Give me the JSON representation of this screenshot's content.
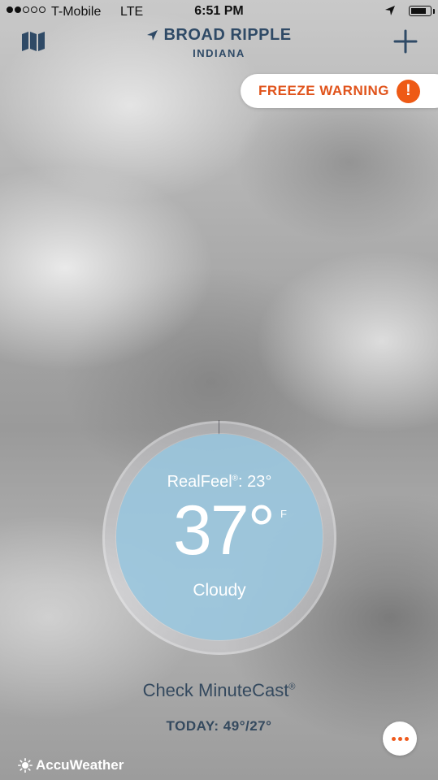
{
  "status_bar": {
    "carrier": "T-Mobile",
    "network": "LTE",
    "time": "6:51 PM",
    "signal_dots_filled": 2,
    "signal_dots_total": 5,
    "battery_level": 0.85
  },
  "header": {
    "city": "BROAD RIPPLE",
    "state": "INDIANA",
    "map_icon": "map-icon",
    "add_icon": "plus-icon"
  },
  "alert": {
    "label": "FREEZE WARNING",
    "icon_glyph": "!",
    "color": "#ee5a15"
  },
  "current": {
    "realfeel_label": "RealFeel",
    "realfeel_mark": "®",
    "realfeel_value": ": 23°",
    "temperature": "37°",
    "unit": "F",
    "condition": "Cloudy"
  },
  "footer": {
    "minutecast_label": "Check MinuteCast",
    "minutecast_mark": "®",
    "today": "TODAY: 49°/27°",
    "more_icon": "more-dots-icon",
    "brand": "AccuWeather"
  },
  "colors": {
    "accent_orange": "#ee5a15",
    "header_text": "#2f4a66",
    "dial_blue": "#96c6de"
  }
}
